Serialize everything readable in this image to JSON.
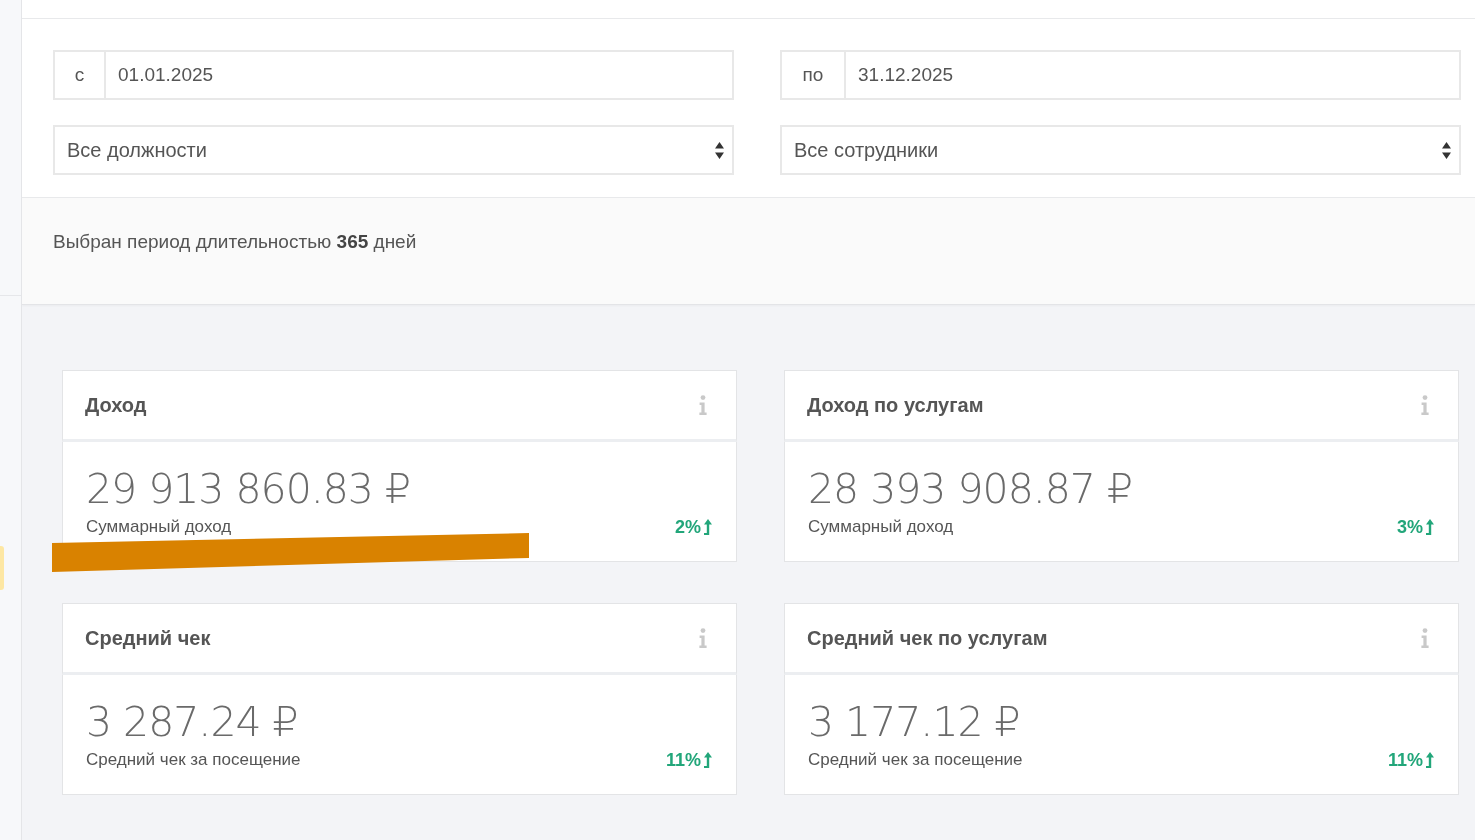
{
  "filters": {
    "date_from": {
      "label": "с",
      "value": "01.01.2025"
    },
    "date_to": {
      "label": "по",
      "value": "31.12.2025"
    },
    "position_select": {
      "value": "Все должности"
    },
    "employee_select": {
      "value": "Все сотрудники"
    }
  },
  "period_note": "Выбран период длительностью **365** дней",
  "cards": [
    {
      "title": "Доход",
      "value": "29 913 860.83 ₽",
      "caption": "Суммарный доход",
      "change": "2%",
      "rising": true,
      "marker_stroke": true
    },
    {
      "title": "Доход по услугам",
      "value": "28 393 908.87 ₽",
      "caption": "Суммарный доход",
      "change": "3%",
      "rising": true
    },
    {
      "title": "Средний чек",
      "value": "3 287.24 ₽",
      "caption": "Средний чек за посещение",
      "change": "11%",
      "rising": true
    },
    {
      "title": "Средний чек по услугам",
      "value": "3 177.12 ₽",
      "caption": "Средний чек за посещение",
      "change": "11%",
      "rising": true
    }
  ]
}
